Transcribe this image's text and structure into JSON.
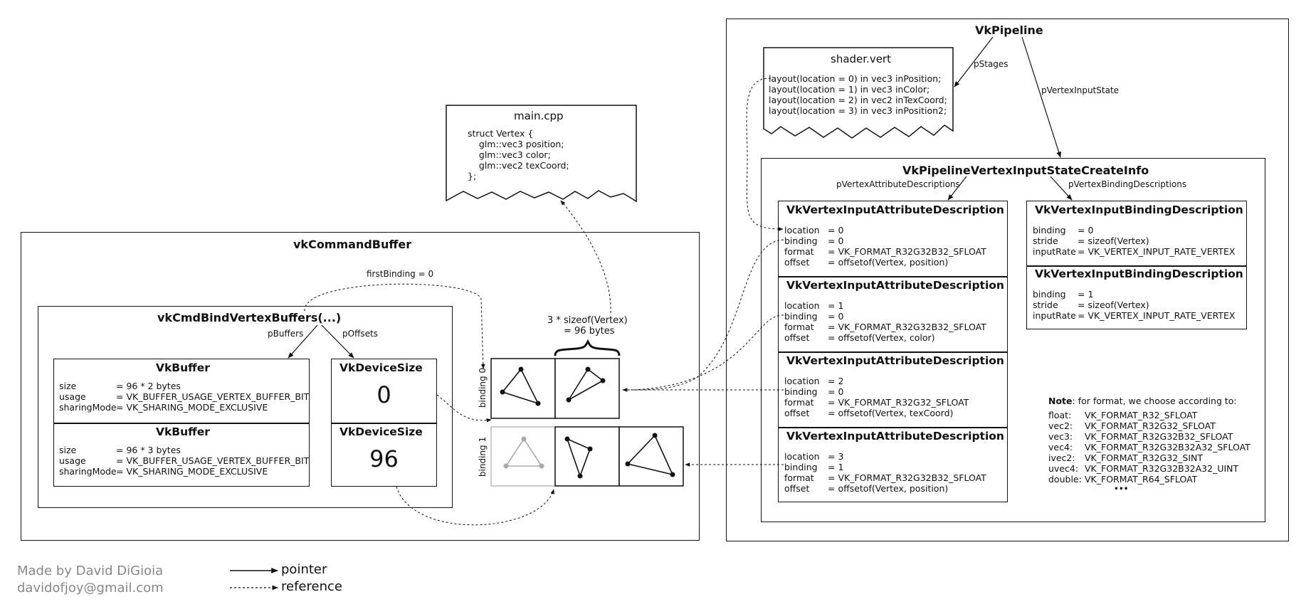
{
  "pipeline": {
    "title": "VkPipeline",
    "p_stages_label": "pStages",
    "p_vertex_input_state_label": "pVertexInputState"
  },
  "shader_vert": {
    "title": "shader.vert",
    "lines": [
      "layout(location = 0) in vec3 inPosition;",
      "layout(location = 1) in vec3 inColor;",
      "layout(location = 2) in vec2 inTexCoord;",
      "layout(location = 3) in vec3 inPosition2;"
    ]
  },
  "main_cpp": {
    "title": "main.cpp",
    "lines": [
      "struct Vertex {",
      "    glm::vec3 position;",
      "    glm::vec3 color;",
      "    glm::vec2 texCoord;",
      "};"
    ]
  },
  "vertex_input_state": {
    "title": "VkPipelineVertexInputStateCreateInfo",
    "attr_label": "pVertexAttributeDescriptions",
    "binding_label": "pVertexBindingDescriptions"
  },
  "attribute_descriptions": [
    {
      "title": "VkVertexInputAttributeDescription",
      "fields": [
        [
          "location",
          "= 0"
        ],
        [
          "binding",
          "= 0"
        ],
        [
          "format",
          "= VK_FORMAT_R32G32B32_SFLOAT"
        ],
        [
          "offset",
          "= offsetof(Vertex, position)"
        ]
      ]
    },
    {
      "title": "VkVertexInputAttributeDescription",
      "fields": [
        [
          "location",
          "= 1"
        ],
        [
          "binding",
          "= 0"
        ],
        [
          "format",
          "= VK_FORMAT_R32G32B32_SFLOAT"
        ],
        [
          "offset",
          "= offsetof(Vertex, color)"
        ]
      ]
    },
    {
      "title": "VkVertexInputAttributeDescription",
      "fields": [
        [
          "location",
          "= 2"
        ],
        [
          "binding",
          "= 0"
        ],
        [
          "format",
          "= VK_FORMAT_R32G32_SFLOAT"
        ],
        [
          "offset",
          "= offsetof(Vertex, texCoord)"
        ]
      ]
    },
    {
      "title": "VkVertexInputAttributeDescription",
      "fields": [
        [
          "location",
          "= 3"
        ],
        [
          "binding",
          "= 1"
        ],
        [
          "format",
          "= VK_FORMAT_R32G32B32_SFLOAT"
        ],
        [
          "offset",
          "= offsetof(Vertex, position)"
        ]
      ]
    }
  ],
  "binding_descriptions": [
    {
      "title": "VkVertexInputBindingDescription",
      "fields": [
        [
          "binding",
          "= 0"
        ],
        [
          "stride",
          "= sizeof(Vertex)"
        ],
        [
          "inputRate",
          "= VK_VERTEX_INPUT_RATE_VERTEX"
        ]
      ]
    },
    {
      "title": "VkVertexInputBindingDescription",
      "fields": [
        [
          "binding",
          "= 1"
        ],
        [
          "stride",
          "= sizeof(Vertex)"
        ],
        [
          "inputRate",
          "= VK_VERTEX_INPUT_RATE_VERTEX"
        ]
      ]
    }
  ],
  "note": {
    "bold": "Note",
    "text": ": for format, we choose according to:",
    "rows": [
      [
        "float:",
        "VK_FORMAT_R32_SFLOAT"
      ],
      [
        "vec2:",
        "VK_FORMAT_R32G32_SFLOAT"
      ],
      [
        "vec3:",
        "VK_FORMAT_R32G32B32_SFLOAT"
      ],
      [
        "vec4:",
        "VK_FORMAT_R32G32B32A32_SFLOAT"
      ],
      [
        "ivec2:",
        "VK_FORMAT_R32G32_SINT"
      ],
      [
        "uvec4:",
        "VK_FORMAT_R32G32B32A32_UINT"
      ],
      [
        "double:",
        "VK_FORMAT_R64_SFLOAT"
      ]
    ],
    "ellipsis": "..."
  },
  "command_buffer": {
    "title": "vkCommandBuffer",
    "first_binding_label": "firstBinding = 0"
  },
  "bind_vertex_buffers": {
    "title": "vkCmdBindVertexBuffers(...)",
    "p_buffers_label": "pBuffers",
    "p_offsets_label": "pOffsets"
  },
  "buffers": [
    {
      "title": "VkBuffer",
      "fields": [
        [
          "size",
          "= 96 * 2 bytes"
        ],
        [
          "usage",
          "= VK_BUFFER_USAGE_VERTEX_BUFFER_BIT"
        ],
        [
          "sharingMode",
          "= VK_SHARING_MODE_EXCLUSIVE"
        ]
      ]
    },
    {
      "title": "VkBuffer",
      "fields": [
        [
          "size",
          "= 96 * 3 bytes"
        ],
        [
          "usage",
          "= VK_BUFFER_USAGE_VERTEX_BUFFER_BIT"
        ],
        [
          "sharingMode",
          "= VK_SHARING_MODE_EXCLUSIVE"
        ]
      ]
    }
  ],
  "device_sizes": [
    {
      "title": "VkDeviceSize",
      "value": "0"
    },
    {
      "title": "VkDeviceSize",
      "value": "96"
    }
  ],
  "bindings": {
    "binding0_label": "binding 0",
    "binding1_label": "binding 1",
    "size_label_line1": "3 * sizeof(Vertex)",
    "size_label_line2": "= 96 bytes"
  },
  "legend": {
    "pointer": "pointer",
    "reference": "reference"
  },
  "credits": {
    "author": "Made by David DiGioia",
    "email": "davidofjoy@gmail.com"
  }
}
